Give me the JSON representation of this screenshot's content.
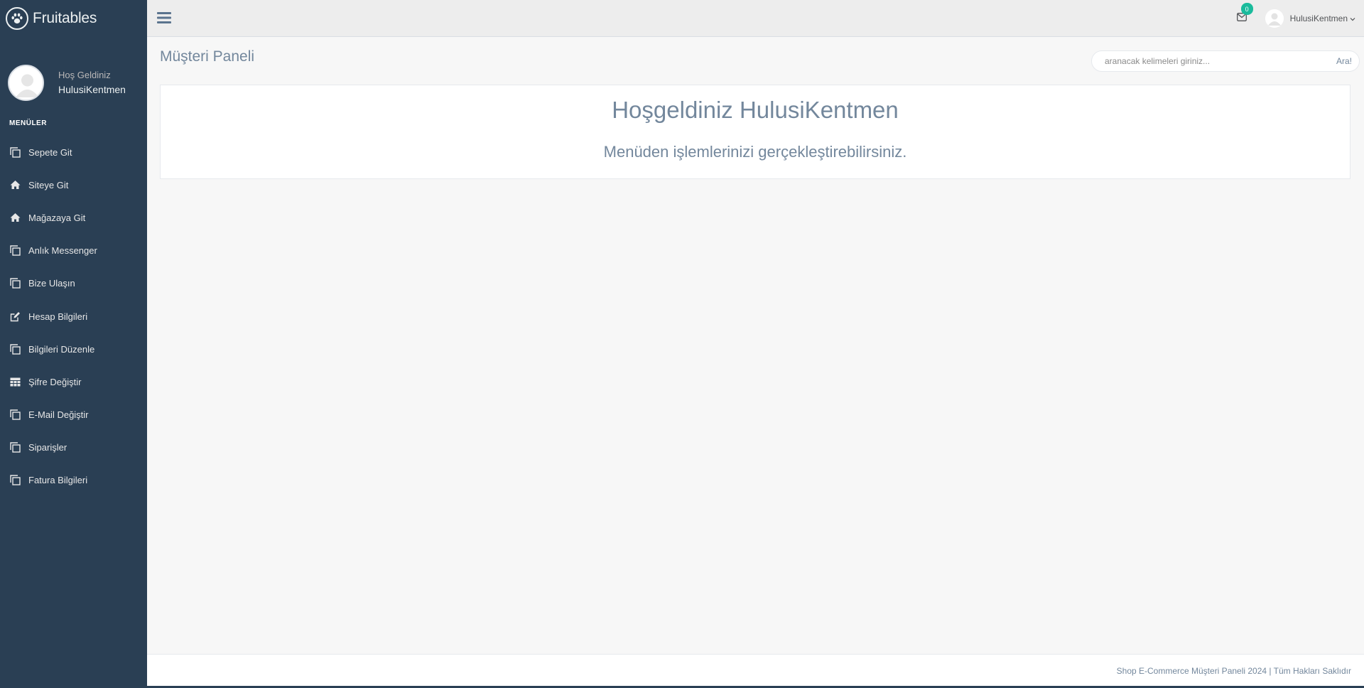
{
  "brand": {
    "name": "Fruitables",
    "icon": "paw-icon"
  },
  "profile": {
    "welcome": "Hoş Geldiniz",
    "name": "HulusiKentmen"
  },
  "sidebar": {
    "section_title": "MENÜLER",
    "items": [
      {
        "label": "Sepete Git",
        "icon": "clone-icon"
      },
      {
        "label": "Siteye Git",
        "icon": "home-icon"
      },
      {
        "label": "Mağazaya Git",
        "icon": "home-icon"
      },
      {
        "label": "Anlık Messenger",
        "icon": "clone-icon"
      },
      {
        "label": "Bize Ulaşın",
        "icon": "clone-icon"
      },
      {
        "label": "Hesap Bilgileri",
        "icon": "edit-icon"
      },
      {
        "label": "Bilgileri Düzenle",
        "icon": "clone-icon"
      },
      {
        "label": "Şifre Değiştir",
        "icon": "table-icon"
      },
      {
        "label": "E-Mail Değiştir",
        "icon": "clone-icon"
      },
      {
        "label": "Siparişler",
        "icon": "clone-icon"
      },
      {
        "label": "Fatura Bilgileri",
        "icon": "clone-icon"
      }
    ]
  },
  "topnav": {
    "mail_count": "0",
    "user_name": "HulusiKentmen"
  },
  "page": {
    "title": "Müşteri Paneli"
  },
  "search": {
    "placeholder": "aranacak kelimeleri giriniz...",
    "button_label": "Ara!"
  },
  "panel": {
    "title": "Hoşgeldiniz HulusiKentmen",
    "subtitle": "Menüden işlemlerinizi gerçekleştirebilirsiniz."
  },
  "footer": {
    "text": "Shop E-Commerce Müşteri Paneli 2024 | Tüm Hakları Saklıdır"
  },
  "colors": {
    "sidebar_bg": "#2A3F54",
    "accent": "#1ABB9C",
    "text": "#73879C"
  }
}
